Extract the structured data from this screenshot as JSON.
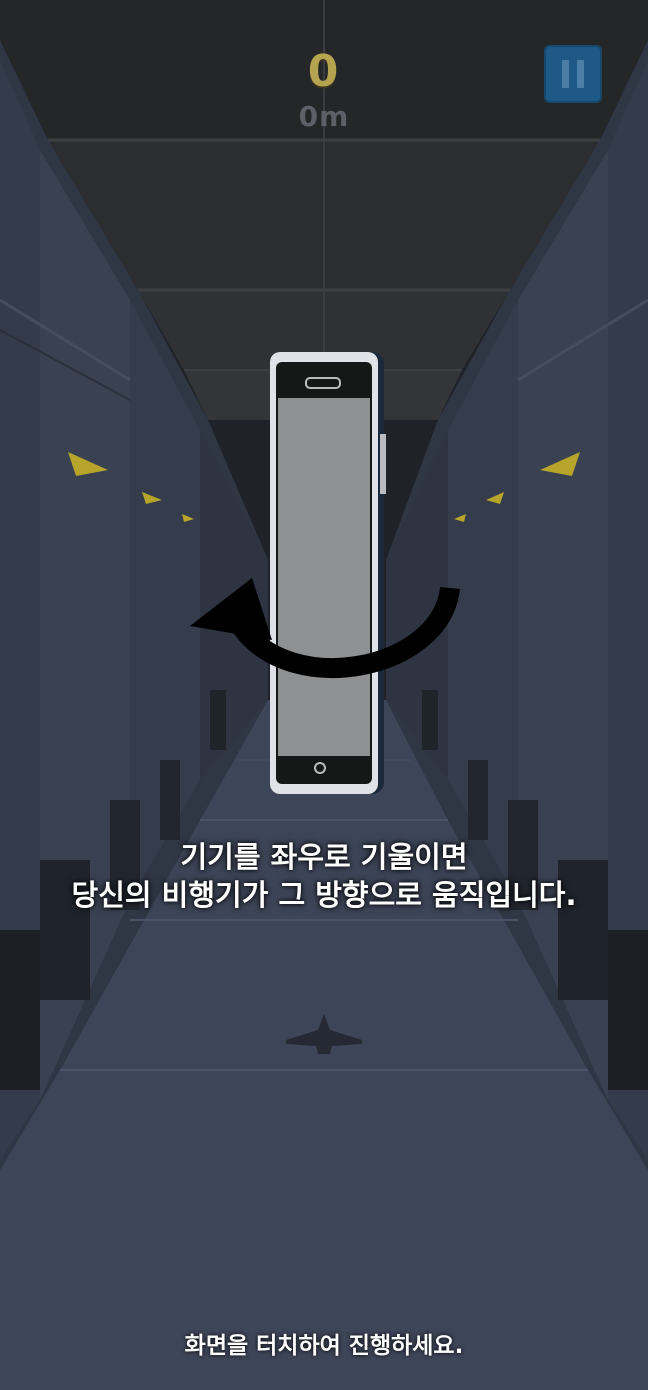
{
  "hud": {
    "score": "0",
    "distance": "0m",
    "pause_icon": "pause-icon"
  },
  "tutorial": {
    "line1": "기기를 좌우로 기울이면",
    "line2": "당신의 비행기가 그 방향으로 움직입니다.",
    "illustration": "phone-tilt-icon",
    "arrow": "curved-arrow-icon"
  },
  "prompt": {
    "text": "화면을 터치하여 진행하세요."
  },
  "colors": {
    "score": "#b5a44f",
    "pause_button": "#1f5a86",
    "floor": "#3d4558",
    "walls": "#2f3644"
  }
}
